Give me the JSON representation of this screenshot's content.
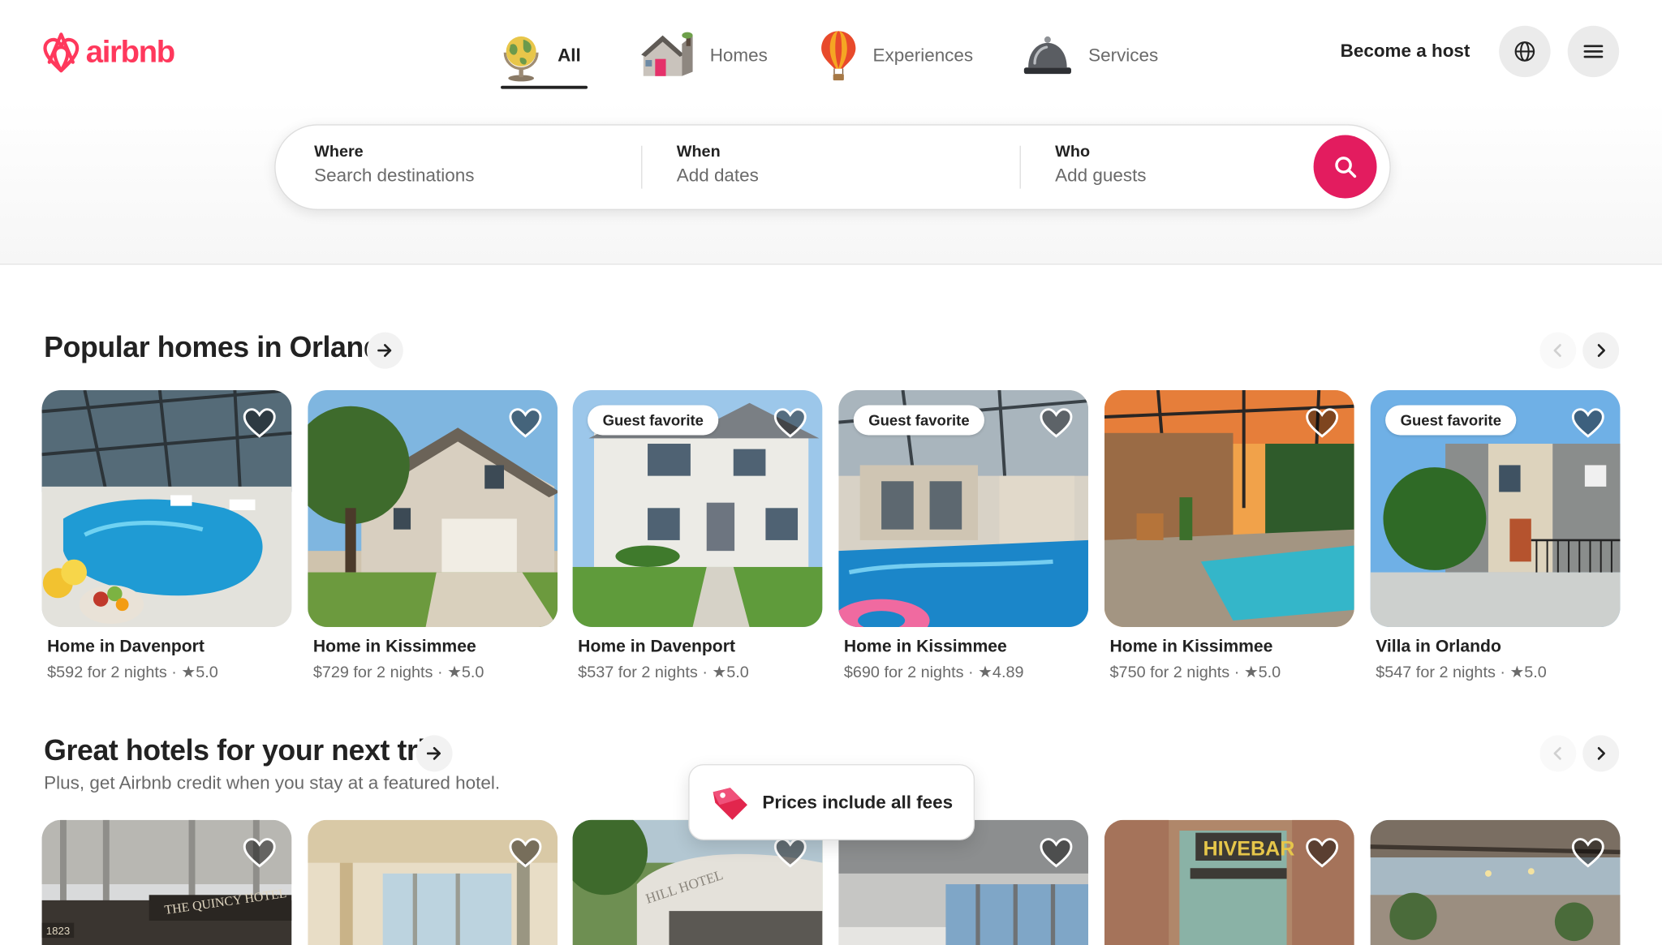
{
  "header": {
    "logo_text": "airbnb",
    "categories": [
      {
        "label": "All",
        "icon": "globe-icon",
        "active": true
      },
      {
        "label": "Homes",
        "icon": "house-icon",
        "active": false
      },
      {
        "label": "Experiences",
        "icon": "hot-air-balloon-icon",
        "active": false
      },
      {
        "label": "Services",
        "icon": "service-bell-icon",
        "active": false
      }
    ],
    "become_host": "Become a host",
    "language_icon": "globe-outline-icon",
    "menu_icon": "hamburger-menu-icon"
  },
  "search": {
    "where_label": "Where",
    "where_placeholder": "Search destinations",
    "when_label": "When",
    "when_placeholder": "Add dates",
    "who_label": "Who",
    "who_placeholder": "Add guests",
    "button_icon": "search-icon",
    "accent": "#E31C5F"
  },
  "popular": {
    "title": "Popular homes in Orlando",
    "listings": [
      {
        "title": "Home in Davenport",
        "price": "$592 for 2 nights",
        "rating": "5.0",
        "badge": ""
      },
      {
        "title": "Home in Kissimmee",
        "price": "$729 for 2 nights",
        "rating": "5.0",
        "badge": ""
      },
      {
        "title": "Home in Davenport",
        "price": "$537 for 2 nights",
        "rating": "5.0",
        "badge": "Guest favorite"
      },
      {
        "title": "Home in Kissimmee",
        "price": "$690 for 2 nights",
        "rating": "4.89",
        "badge": "Guest favorite"
      },
      {
        "title": "Home in Kissimmee",
        "price": "$750 for 2 nights",
        "rating": "5.0",
        "badge": ""
      },
      {
        "title": "Villa in Orlando",
        "price": "$547 for 2 nights",
        "rating": "5.0",
        "badge": "Guest favorite"
      }
    ]
  },
  "hotels": {
    "title": "Great hotels for your next trip",
    "subtitle": "Plus, get Airbnb credit when you stay at a featured hotel.",
    "photo_texts": [
      "THE QUINCY HOTEL",
      "1823",
      "HILL HOTEL",
      "HIVEBAR"
    ]
  },
  "toast": {
    "text": "Prices include all fees",
    "icon": "price-tag-icon"
  },
  "symbols": {
    "star": "★",
    "separator": "·"
  },
  "colors": {
    "brand": "#FF385C",
    "text": "#222222",
    "muted": "#6A6A6A"
  }
}
